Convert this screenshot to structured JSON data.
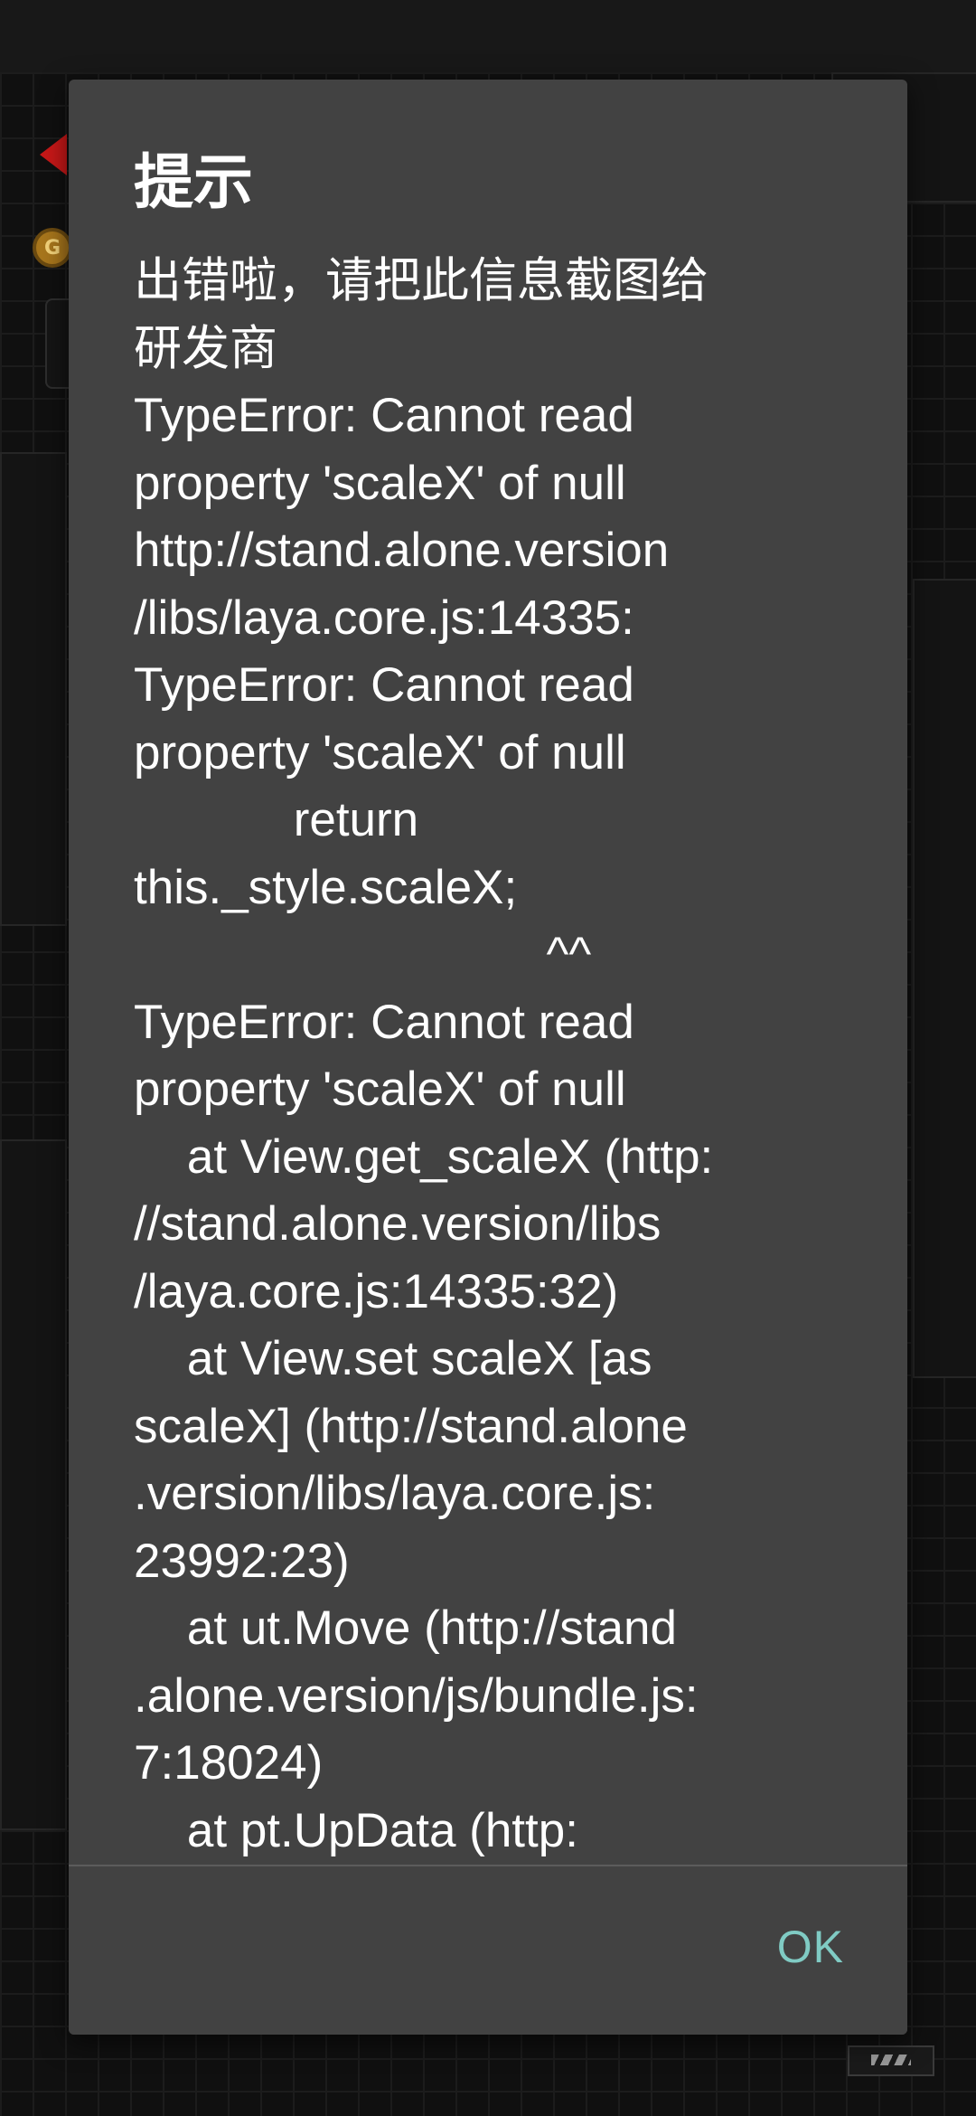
{
  "dialog": {
    "title": "提示",
    "message_lines": [
      "出错啦，请把此信息截图给",
      "研发商",
      "TypeError: Cannot read",
      "property 'scaleX' of null",
      "http://stand.alone.version",
      "/libs/laya.core.js:14335:",
      "TypeError: Cannot read",
      "property 'scaleX' of null",
      "            return",
      "this._style.scaleX;",
      "                               ^^",
      "TypeError: Cannot read",
      "property 'scaleX' of null",
      "    at View.get_scaleX (http:",
      "//stand.alone.version/libs",
      "/laya.core.js:14335:32)",
      "    at View.set scaleX [as",
      "scaleX] (http://stand.alone",
      ".version/libs/laya.core.js:",
      "23992:23)",
      "    at ut.Move (http://stand",
      ".alone.version/js/bundle.js:",
      "7:18024)",
      "    at pt.UpData (http:"
    ],
    "ok_label": "OK",
    "accent_color": "#80cbc4",
    "background_color": "#424242"
  },
  "background": {
    "coin_letter": "G"
  }
}
